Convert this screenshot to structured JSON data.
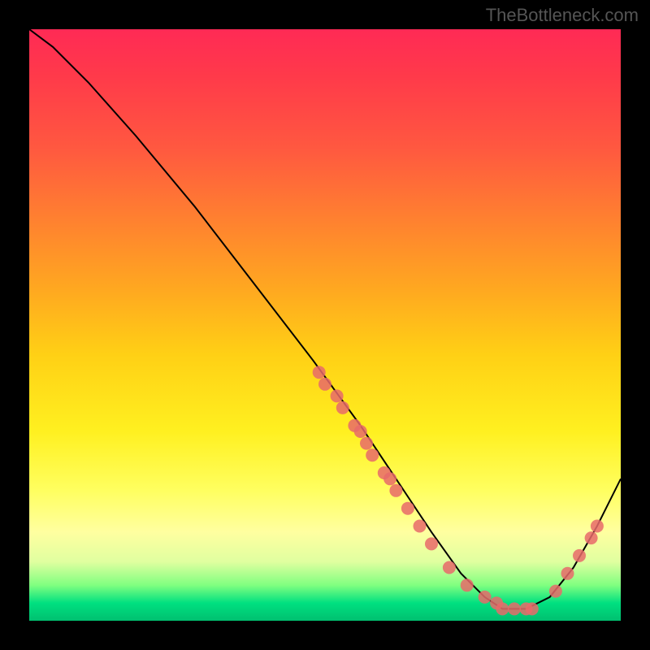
{
  "watermark": "TheBottleneck.com",
  "chart_data": {
    "type": "line",
    "title": "",
    "xlabel": "",
    "ylabel": "",
    "xlim": [
      0,
      100
    ],
    "ylim": [
      0,
      100
    ],
    "grid": false,
    "legend": false,
    "background": "rainbow-gradient",
    "series": [
      {
        "name": "curve",
        "x": [
          0,
          4,
          10,
          18,
          28,
          38,
          48,
          56,
          62,
          68,
          73,
          77,
          80,
          84,
          88,
          92,
          96,
          100
        ],
        "y": [
          100,
          97,
          91,
          82,
          70,
          57,
          44,
          33,
          24,
          15,
          8,
          4,
          2,
          2,
          4,
          9,
          16,
          24
        ]
      }
    ],
    "points": [
      {
        "x": 49,
        "y": 42
      },
      {
        "x": 50,
        "y": 40
      },
      {
        "x": 52,
        "y": 38
      },
      {
        "x": 53,
        "y": 36
      },
      {
        "x": 55,
        "y": 33
      },
      {
        "x": 56,
        "y": 32
      },
      {
        "x": 57,
        "y": 30
      },
      {
        "x": 58,
        "y": 28
      },
      {
        "x": 60,
        "y": 25
      },
      {
        "x": 61,
        "y": 24
      },
      {
        "x": 62,
        "y": 22
      },
      {
        "x": 64,
        "y": 19
      },
      {
        "x": 66,
        "y": 16
      },
      {
        "x": 68,
        "y": 13
      },
      {
        "x": 71,
        "y": 9
      },
      {
        "x": 74,
        "y": 6
      },
      {
        "x": 77,
        "y": 4
      },
      {
        "x": 79,
        "y": 3
      },
      {
        "x": 80,
        "y": 2
      },
      {
        "x": 82,
        "y": 2
      },
      {
        "x": 84,
        "y": 2
      },
      {
        "x": 85,
        "y": 2
      },
      {
        "x": 89,
        "y": 5
      },
      {
        "x": 91,
        "y": 8
      },
      {
        "x": 93,
        "y": 11
      },
      {
        "x": 95,
        "y": 14
      },
      {
        "x": 96,
        "y": 16
      }
    ]
  }
}
